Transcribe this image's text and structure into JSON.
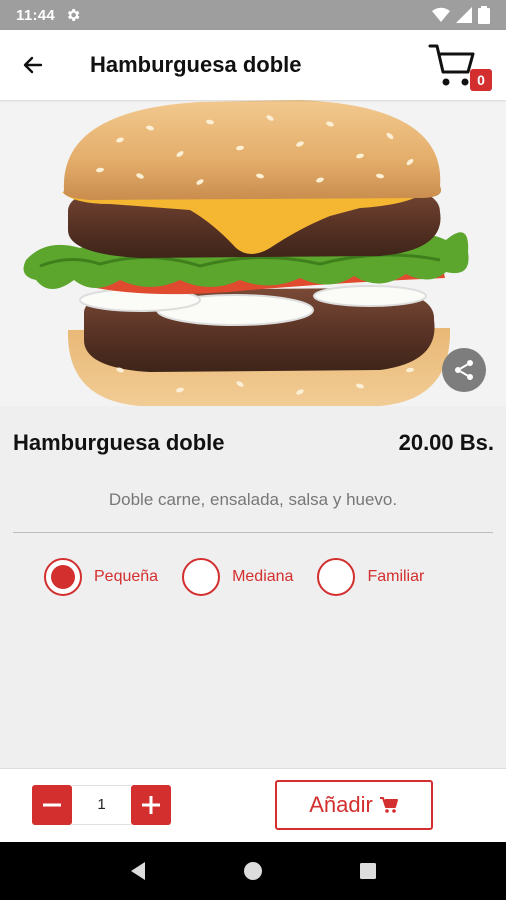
{
  "status_bar": {
    "time": "11:44"
  },
  "app_bar": {
    "title": "Hamburguesa doble",
    "cart_count": "0"
  },
  "product": {
    "name": "Hamburguesa doble",
    "price": "20.00 Bs.",
    "description": "Doble carne, ensalada, salsa y huevo."
  },
  "sizes": [
    {
      "label": "Pequeña",
      "selected": true
    },
    {
      "label": "Mediana",
      "selected": false
    },
    {
      "label": "Familiar",
      "selected": false
    }
  ],
  "order": {
    "quantity": "1",
    "add_label": "Añadir"
  },
  "colors": {
    "accent": "#d32f2f",
    "status_bar": "#9e9e9e",
    "background": "#efefef"
  },
  "icons": [
    "gear-icon",
    "wifi-icon",
    "signal-icon",
    "battery-icon",
    "back-arrow-icon",
    "cart-icon",
    "share-icon",
    "minus-icon",
    "plus-icon",
    "nav-back-icon",
    "nav-home-icon",
    "nav-recents-icon"
  ]
}
